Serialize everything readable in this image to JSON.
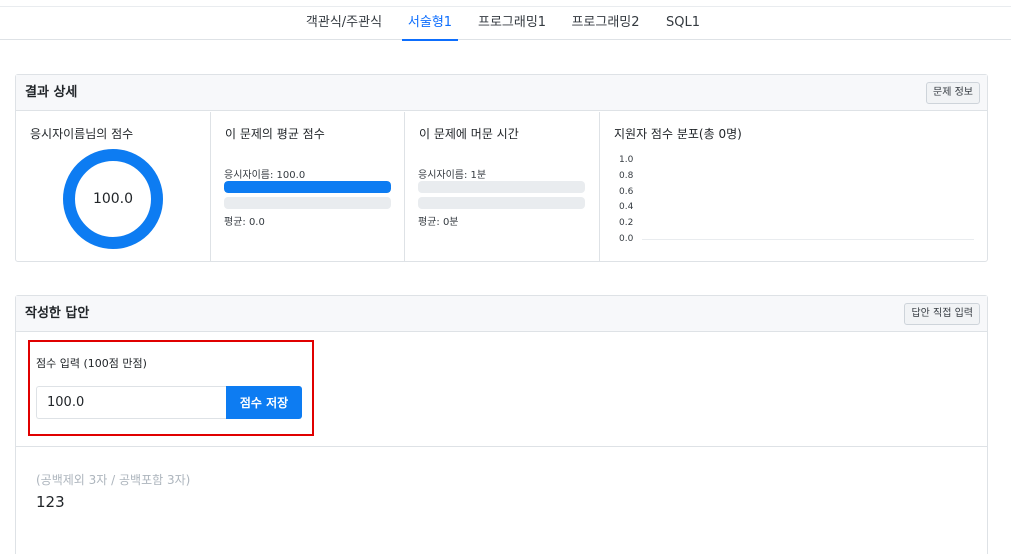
{
  "tabs": [
    {
      "label": "객관식/주관식",
      "active": false
    },
    {
      "label": "서술형1",
      "active": true
    },
    {
      "label": "프로그래밍1",
      "active": false
    },
    {
      "label": "프로그래밍2",
      "active": false
    },
    {
      "label": "SQL1",
      "active": false
    }
  ],
  "result": {
    "title": "결과 상세",
    "info_button": "문제 정보",
    "score_panel": {
      "title": "응시자이름님의 점수",
      "score": "100.0",
      "score_fraction": 1.0
    },
    "avg_panel": {
      "title": "이 문제의 평균 점수",
      "candidate_label": "응시자이름: 100.0",
      "candidate_fraction": 1.0,
      "average_label": "평균: 0.0",
      "average_fraction": 0.0
    },
    "time_panel": {
      "title": "이 문제에 머문 시간",
      "candidate_label": "응시자이름: 1분",
      "candidate_fraction": 0.0,
      "average_label": "평균: 0분",
      "average_fraction": 0.0
    },
    "dist_panel": {
      "title": "지원자 점수 분포(총 0명)",
      "y_ticks": [
        "1.0",
        "0.8",
        "0.6",
        "0.4",
        "0.2",
        "0.0"
      ]
    }
  },
  "answer": {
    "title": "작성한 답안",
    "direct_input_button": "답안 직접 입력",
    "score_input_label": "점수 입력 (100점 만점)",
    "score_value": "100.0",
    "save_button": "점수 저장",
    "char_count": "(공백제외 3자 / 공백포함 3자)",
    "answer_text": "123"
  },
  "colors": {
    "accent": "#0d7cf2",
    "highlight": "#e00000",
    "track": "#e9ecef"
  },
  "chart_data": {
    "type": "bar",
    "title": "지원자 점수 분포(총 0명)",
    "categories": [],
    "values": [],
    "ylim": [
      0,
      1.0
    ],
    "y_ticks": [
      1.0,
      0.8,
      0.6,
      0.4,
      0.2,
      0.0
    ],
    "grid": false
  }
}
